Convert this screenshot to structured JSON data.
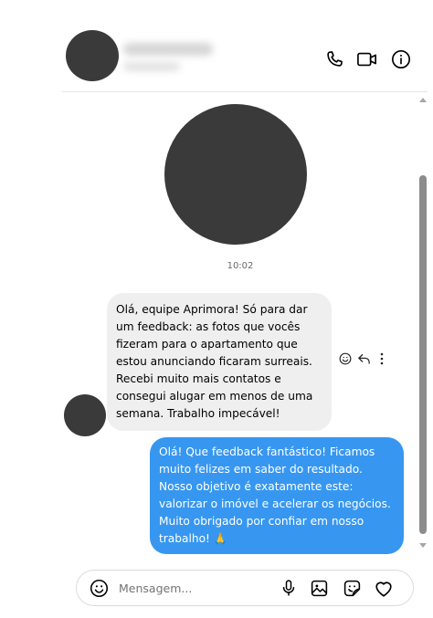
{
  "conversation": {
    "time": "10:02",
    "incoming": {
      "text": "Olá, equipe Aprimora! Só para dar um feedback: as fotos que vocês fizeram para o apartamento que estou anunciando ficaram surreais. Recebi muito mais contatos e consegui alugar em menos de uma semana. Trabalho impecável!"
    },
    "outgoing": {
      "text": "Olá! Que feedback fantástico! Ficamos muito felizes em saber do resultado. Nosso objetivo é exatamente este: valorizar o imóvel e acelerar os negócios. Muito obrigado por confiar em nosso trabalho! 🙏"
    }
  },
  "header_icons": [
    "phone-icon",
    "video-camera-icon",
    "info-icon"
  ],
  "message_actions": [
    "emoji-react-icon",
    "reply-icon",
    "more-options-icon"
  ],
  "composer": {
    "placeholder": "Mensagem...",
    "icons": [
      "emoji-icon",
      "microphone-icon",
      "image-icon",
      "sticker-icon",
      "heart-icon"
    ]
  },
  "colors": {
    "outgoing_bubble": "#3797f0",
    "incoming_bubble": "#efefef",
    "avatar_redaction": "#3a3a3a"
  }
}
